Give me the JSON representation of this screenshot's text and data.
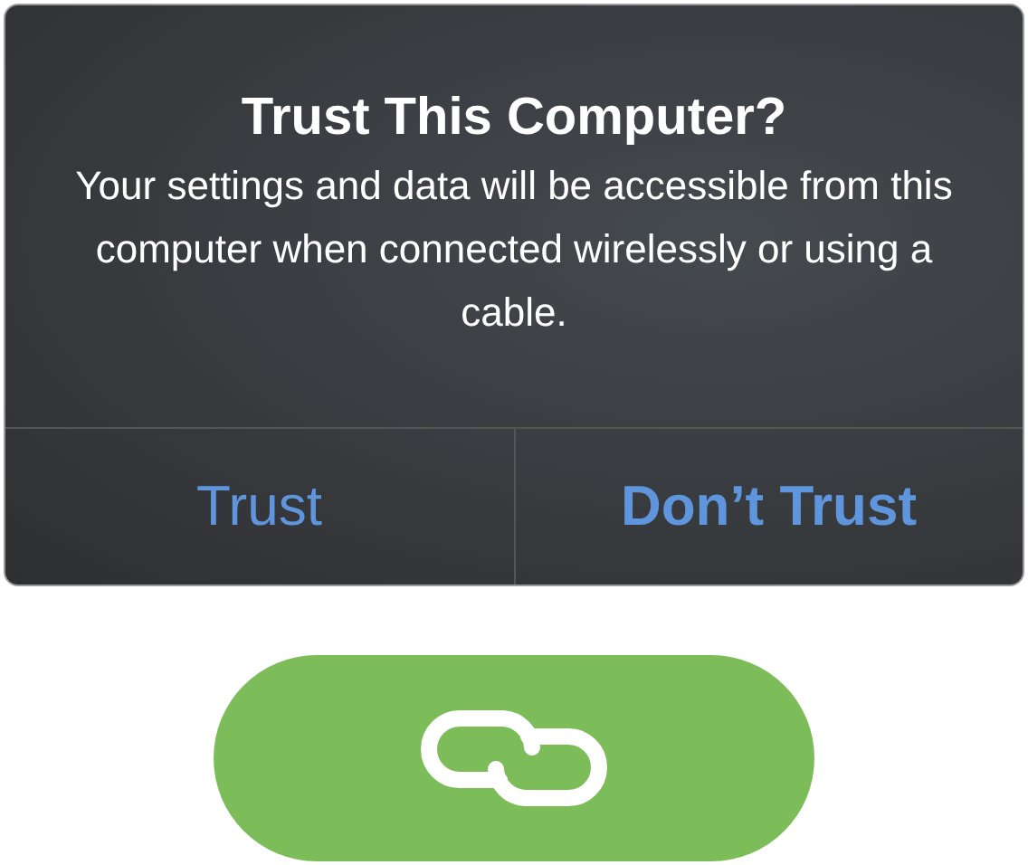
{
  "alert": {
    "title": "Trust This Computer?",
    "message": "Your settings and data will be accessible from this computer when connected wirelessly or using a cable.",
    "buttons": [
      {
        "label": "Trust",
        "emphasized": false
      },
      {
        "label": "Don’t Trust",
        "emphasized": true
      }
    ]
  }
}
